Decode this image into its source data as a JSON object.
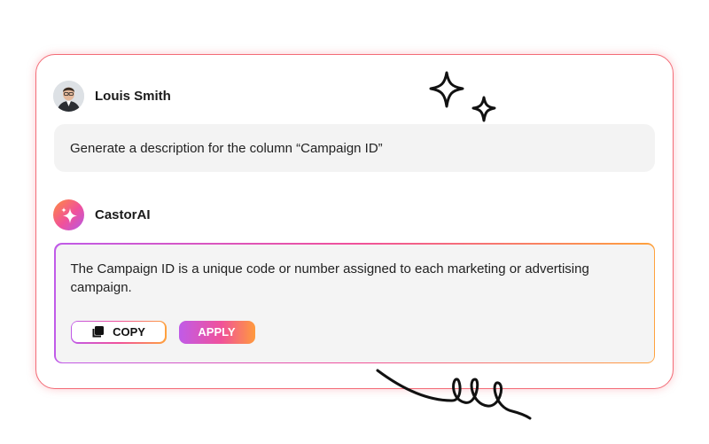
{
  "user": {
    "name": "Louis Smith",
    "prompt": "Generate a description for the column “Campaign ID”"
  },
  "assistant": {
    "name": "CastorAI",
    "response": "The Campaign ID is a unique code or number assigned to each marketing or advertising campaign."
  },
  "actions": {
    "copy_label": "COPY",
    "apply_label": "APPLY"
  },
  "colors": {
    "card_border": "#f36b76",
    "gradient_purple": "#c05be8",
    "gradient_pink": "#f0519b",
    "gradient_orange": "#ffa23d",
    "bubble_bg": "#f3f3f3"
  },
  "icons": [
    "sparkle-icon",
    "copy-icon",
    "castorai-logo-icon"
  ]
}
